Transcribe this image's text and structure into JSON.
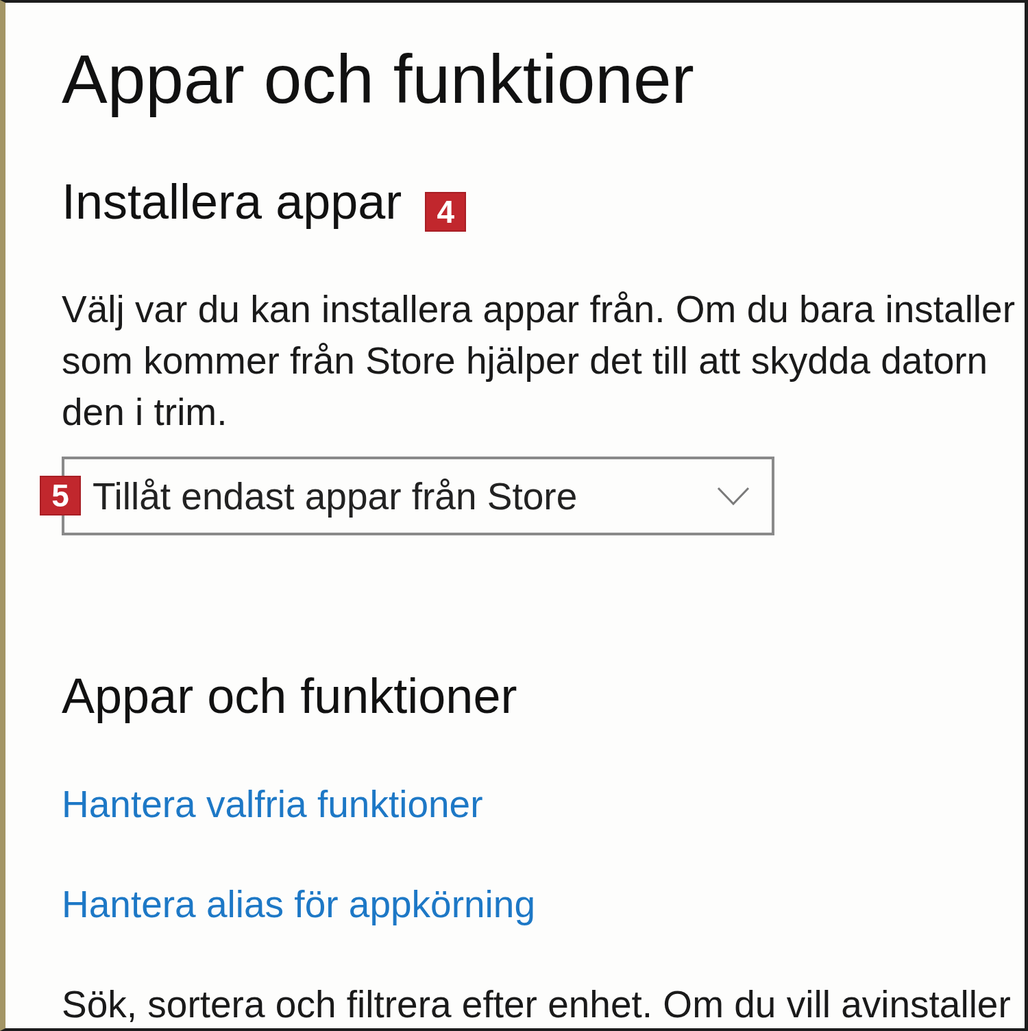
{
  "page_title": "Appar och funktioner",
  "install_section": {
    "heading": "Installera appar",
    "callout": "4",
    "description_lines": [
      "Välj var du kan installera appar från. Om du bara installer",
      "som kommer från Store hjälper det till att skydda datorn",
      "den i trim."
    ],
    "dropdown": {
      "value": "Tillåt endast appar från Store",
      "callout": "5"
    }
  },
  "apps_section": {
    "heading": "Appar och funktioner",
    "links": [
      "Hantera valfria funktioner",
      "Hantera alias för appkörning"
    ],
    "description": "Sök, sortera och filtrera efter enhet. Om du vill avinstaller"
  }
}
